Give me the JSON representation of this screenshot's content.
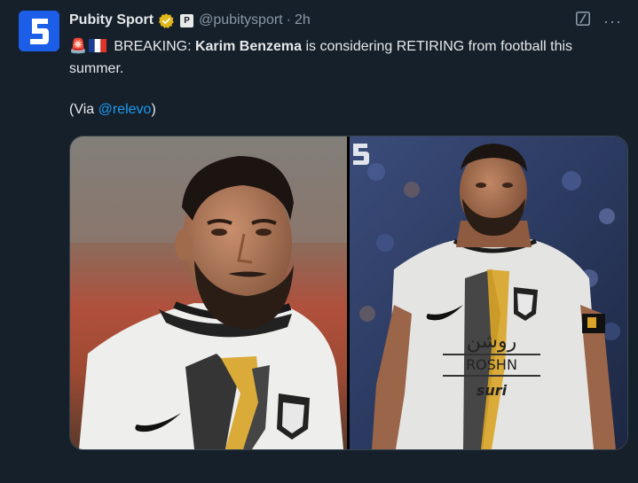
{
  "author": {
    "name": "Pubity Sport",
    "handle": "@pubitysport",
    "separator": "·",
    "time": "2h",
    "avatar_icon": "pubity-logo-icon",
    "verified_icon": "gold-verified-badge-icon",
    "affiliate_badge": "P"
  },
  "tweet": {
    "alert_emoji": "🚨",
    "flag_icon": "france-flag-icon",
    "breaking": "BREAKING:",
    "subject": "Karim Benzema",
    "rest": "is considering RETIRING from football this summer.",
    "via_prefix": "(Via",
    "via_link": "@relevo",
    "via_suffix": ")"
  },
  "jersey_text": {
    "arabic": "روشن",
    "sponsor": "ROSHN",
    "sleeve": "suri"
  },
  "colors": {
    "background": "#15202b",
    "accent": "#1d9bf0",
    "verified_gold": "#e2b719",
    "muted": "#8b98a5"
  }
}
